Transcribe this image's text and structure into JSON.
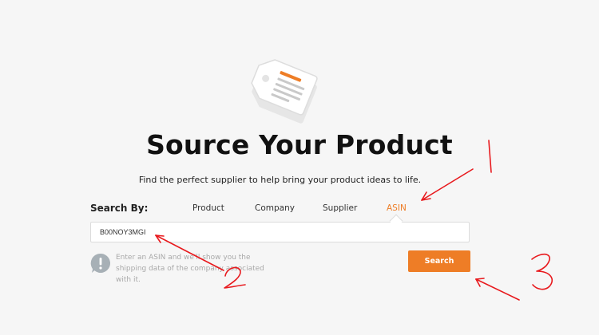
{
  "hero": {
    "icon": "price-tag-illustration",
    "title": "Source Your Product",
    "subtitle": "Find the perfect supplier to help bring your product ideas to life."
  },
  "search": {
    "label": "Search By:",
    "tabs": [
      {
        "label": "Product",
        "active": false
      },
      {
        "label": "Company",
        "active": false
      },
      {
        "label": "Supplier",
        "active": false
      },
      {
        "label": "ASIN",
        "active": true
      }
    ],
    "input_value": "B00NOY3MGI",
    "hint": "Enter an ASIN and we'll show you the shipping data of the company associated with it.",
    "hint_icon": "info-exclamation-icon",
    "button_label": "Search"
  },
  "annotations": {
    "color": "#e8191d",
    "numbers": [
      "1",
      "2",
      "3"
    ]
  },
  "colors": {
    "accent": "#ee7d26",
    "background": "#f6f6f6",
    "hint_text": "#a9a9a9"
  }
}
